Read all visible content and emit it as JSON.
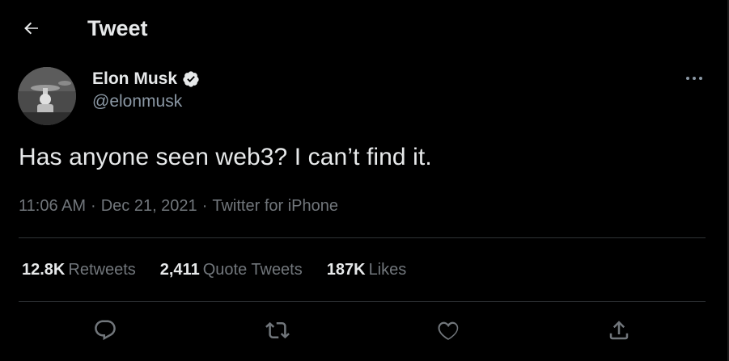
{
  "header": {
    "title": "Tweet",
    "back_icon": "arrow-left-icon"
  },
  "author": {
    "display_name": "Elon Musk",
    "handle": "@elonmusk",
    "verified_icon": "verified-badge-icon",
    "avatar": "avatar"
  },
  "more_icon": "more-horizontal-icon",
  "tweet": {
    "text": "Has anyone seen web3? I can’t find it.",
    "time": "11:06 AM",
    "date": "Dec 21, 2021",
    "separator": "·",
    "source": "Twitter for iPhone"
  },
  "stats": {
    "retweets_count": "12.8K",
    "retweets_label": "Retweets",
    "quotes_count": "2,411",
    "quotes_label": "Quote Tweets",
    "likes_count": "187K",
    "likes_label": "Likes"
  },
  "actions": [
    "reply-icon",
    "retweet-icon",
    "like-icon",
    "share-icon"
  ],
  "colors": {
    "background": "#000000",
    "primary_text": "#e7e9ea",
    "secondary_text": "#71767b",
    "divider": "#2f3336"
  }
}
